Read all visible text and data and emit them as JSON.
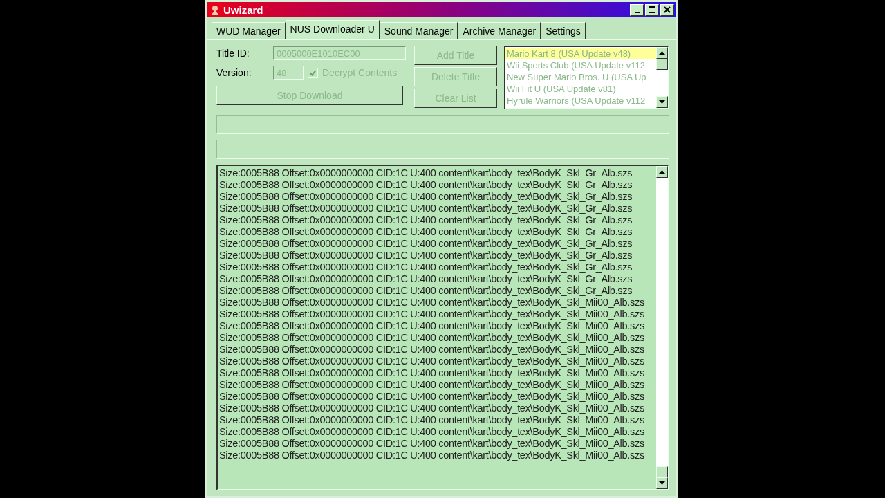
{
  "window": {
    "title": "Uwizard"
  },
  "tabs": [
    {
      "label": "WUD Manager",
      "selected": false
    },
    {
      "label": "NUS Downloader U",
      "selected": true
    },
    {
      "label": "Sound Manager",
      "selected": false
    },
    {
      "label": "Archive Manager",
      "selected": false
    },
    {
      "label": "Settings",
      "selected": false
    }
  ],
  "title_id": {
    "label": "Title ID:",
    "value": "0005000E1010EC00",
    "disabled": true
  },
  "version": {
    "label": "Version:",
    "value": "48",
    "disabled": true
  },
  "decrypt": {
    "label": "Decrypt Contents",
    "checked": true,
    "disabled": true
  },
  "stop_button": {
    "label": "Stop Download",
    "disabled": true
  },
  "buttons": [
    {
      "label": "Add Title",
      "disabled": true
    },
    {
      "label": "Delete Title",
      "disabled": true
    },
    {
      "label": "Clear List",
      "disabled": true
    }
  ],
  "title_list": [
    {
      "label": "Mario Kart 8 (USA Update v48)",
      "selected": true
    },
    {
      "label": "Wii Sports Club (USA Update v112",
      "selected": false
    },
    {
      "label": "New Super Mario Bros. U (USA Up",
      "selected": false
    },
    {
      "label": "Wii Fit U (USA Update v81)",
      "selected": false
    },
    {
      "label": "Hyrule Warriors (USA Update v112",
      "selected": false
    }
  ],
  "log": [
    "Size:0005B88 Offset:0x0000000000 CID:1C U:400 content\\kart\\body_tex\\BodyK_Skl_Gr_Alb.szs",
    "Size:0005B88 Offset:0x0000000000 CID:1C U:400 content\\kart\\body_tex\\BodyK_Skl_Gr_Alb.szs",
    "Size:0005B88 Offset:0x0000000000 CID:1C U:400 content\\kart\\body_tex\\BodyK_Skl_Gr_Alb.szs",
    "Size:0005B88 Offset:0x0000000000 CID:1C U:400 content\\kart\\body_tex\\BodyK_Skl_Gr_Alb.szs",
    "Size:0005B88 Offset:0x0000000000 CID:1C U:400 content\\kart\\body_tex\\BodyK_Skl_Gr_Alb.szs",
    "Size:0005B88 Offset:0x0000000000 CID:1C U:400 content\\kart\\body_tex\\BodyK_Skl_Gr_Alb.szs",
    "Size:0005B88 Offset:0x0000000000 CID:1C U:400 content\\kart\\body_tex\\BodyK_Skl_Gr_Alb.szs",
    "Size:0005B88 Offset:0x0000000000 CID:1C U:400 content\\kart\\body_tex\\BodyK_Skl_Gr_Alb.szs",
    "Size:0005B88 Offset:0x0000000000 CID:1C U:400 content\\kart\\body_tex\\BodyK_Skl_Gr_Alb.szs",
    "Size:0005B88 Offset:0x0000000000 CID:1C U:400 content\\kart\\body_tex\\BodyK_Skl_Gr_Alb.szs",
    "Size:0005B88 Offset:0x0000000000 CID:1C U:400 content\\kart\\body_tex\\BodyK_Skl_Gr_Alb.szs",
    "Size:0005B88 Offset:0x0000000000 CID:1C U:400 content\\kart\\body_tex\\BodyK_Skl_Mii00_Alb.szs",
    "Size:0005B88 Offset:0x0000000000 CID:1C U:400 content\\kart\\body_tex\\BodyK_Skl_Mii00_Alb.szs",
    "Size:0005B88 Offset:0x0000000000 CID:1C U:400 content\\kart\\body_tex\\BodyK_Skl_Mii00_Alb.szs",
    "Size:0005B88 Offset:0x0000000000 CID:1C U:400 content\\kart\\body_tex\\BodyK_Skl_Mii00_Alb.szs",
    "Size:0005B88 Offset:0x0000000000 CID:1C U:400 content\\kart\\body_tex\\BodyK_Skl_Mii00_Alb.szs",
    "Size:0005B88 Offset:0x0000000000 CID:1C U:400 content\\kart\\body_tex\\BodyK_Skl_Mii00_Alb.szs",
    "Size:0005B88 Offset:0x0000000000 CID:1C U:400 content\\kart\\body_tex\\BodyK_Skl_Mii00_Alb.szs",
    "Size:0005B88 Offset:0x0000000000 CID:1C U:400 content\\kart\\body_tex\\BodyK_Skl_Mii00_Alb.szs",
    "Size:0005B88 Offset:0x0000000000 CID:1C U:400 content\\kart\\body_tex\\BodyK_Skl_Mii00_Alb.szs",
    "Size:0005B88 Offset:0x0000000000 CID:1C U:400 content\\kart\\body_tex\\BodyK_Skl_Mii00_Alb.szs",
    "Size:0005B88 Offset:0x0000000000 CID:1C U:400 content\\kart\\body_tex\\BodyK_Skl_Mii00_Alb.szs",
    "Size:0005B88 Offset:0x0000000000 CID:1C U:400 content\\kart\\body_tex\\BodyK_Skl_Mii00_Alb.szs",
    "Size:0005B88 Offset:0x0000000000 CID:1C U:400 content\\kart\\body_tex\\BodyK_Skl_Mii00_Alb.szs",
    "Size:0005B88 Offset:0x0000000000 CID:1C U:400 content\\kart\\body_tex\\BodyK_Skl_Mii00_Alb.szs"
  ]
}
